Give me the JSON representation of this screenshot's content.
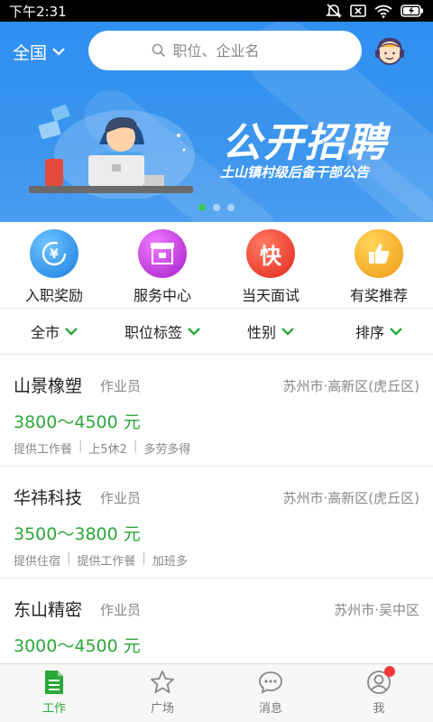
{
  "status_bar": {
    "time": "下午2:31",
    "battery_icon": "battery-charging-icon",
    "wifi_icon": "wifi-icon",
    "mute_icon": "mute-icon",
    "sim_icon": "no-sim-icon"
  },
  "header": {
    "region": "全国",
    "search_placeholder": "职位、企业名",
    "service_icon": "customer-service-icon"
  },
  "banner": {
    "title": "公开招聘",
    "subtitle": "土山镇村级后备干部公告",
    "slides": 3,
    "active_slide": 1
  },
  "quick_entries": [
    {
      "label": "入职奖励",
      "icon": "yen-refresh-icon",
      "color": "#2b8de8"
    },
    {
      "label": "服务中心",
      "icon": "storefront-icon",
      "color": "#c12fd8"
    },
    {
      "label": "当天面试",
      "icon": "kuai-icon",
      "glyph": "快",
      "color": "#f03a2c"
    },
    {
      "label": "有奖推荐",
      "icon": "thumbs-up-icon",
      "color": "#f2a51a"
    }
  ],
  "filters": [
    {
      "label": "全市"
    },
    {
      "label": "职位标签"
    },
    {
      "label": "性别"
    },
    {
      "label": "排序"
    }
  ],
  "jobs": [
    {
      "company": "山景橡塑",
      "position": "作业员",
      "location": "苏州市·高新区(虎丘区)",
      "salary": "3800～4500 元",
      "tags": [
        "提供工作餐",
        "上5休2",
        "多劳多得"
      ]
    },
    {
      "company": "华祎科技",
      "position": "作业员",
      "location": "苏州市·高新区(虎丘区)",
      "salary": "3500～3800 元",
      "tags": [
        "提供住宿",
        "提供工作餐",
        "加班多"
      ]
    },
    {
      "company": "东山精密",
      "position": "作业员",
      "location": "苏州市·吴中区",
      "salary": "3000～4500 元",
      "tags": []
    }
  ],
  "bottom_nav": [
    {
      "label": "工作",
      "icon": "document-icon",
      "active": true
    },
    {
      "label": "广场",
      "icon": "star-icon",
      "active": false
    },
    {
      "label": "消息",
      "icon": "chat-bubble-icon",
      "active": false
    },
    {
      "label": "我",
      "icon": "user-avatar-icon",
      "active": false,
      "badge": true
    }
  ],
  "colors": {
    "primary_blue": "#3b95ee",
    "accent_green": "#2ba83a",
    "badge_red": "#f23a3a"
  }
}
